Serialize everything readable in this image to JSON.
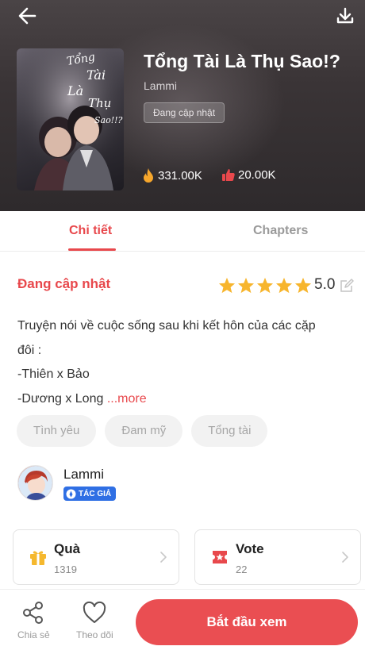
{
  "header": {
    "title": "Tổng Tài Là Thụ Sao!?",
    "author": "Lammi",
    "status": "Đang cập nhật",
    "views": "331.00K",
    "likes": "20.00K",
    "cover_text": [
      "Tổng",
      "Tài",
      "Là",
      "Thụ",
      "Sao!!?"
    ],
    "icons": {
      "back": "arrow-left-icon",
      "download": "download-icon",
      "views": "fire-icon",
      "likes": "thumbs-up-icon"
    }
  },
  "tabs": [
    {
      "label": "Chi tiết",
      "active": true
    },
    {
      "label": "Chapters",
      "active": false
    }
  ],
  "details": {
    "status": "Đang cập nhật",
    "rating": "5.0",
    "stars": 5,
    "description_lines": [
      "Truyện nói về cuộc sống sau khi kết hôn của các cặp",
      "đôi :",
      "-Thiên x Bảo",
      "-Dương x Long"
    ],
    "more_label": "...more",
    "tags": [
      "Tình yêu",
      "Đam mỹ",
      "Tổng tài"
    ]
  },
  "author": {
    "name": "Lammi",
    "badge": "TÁC GIẢ"
  },
  "cards": [
    {
      "title": "Quà",
      "count": "1319",
      "icon": "gift-icon"
    },
    {
      "title": "Vote",
      "count": "22",
      "icon": "ticket-icon"
    }
  ],
  "bottom_bar": {
    "share_label": "Chia sẻ",
    "follow_label": "Theo dõi",
    "start_label": "Bắt đầu xem"
  },
  "colors": {
    "accent": "#e8484c",
    "star": "#f7b52d",
    "badge": "#2f6fe4",
    "gift": "#f5b82e",
    "vote": "#e8484c"
  }
}
